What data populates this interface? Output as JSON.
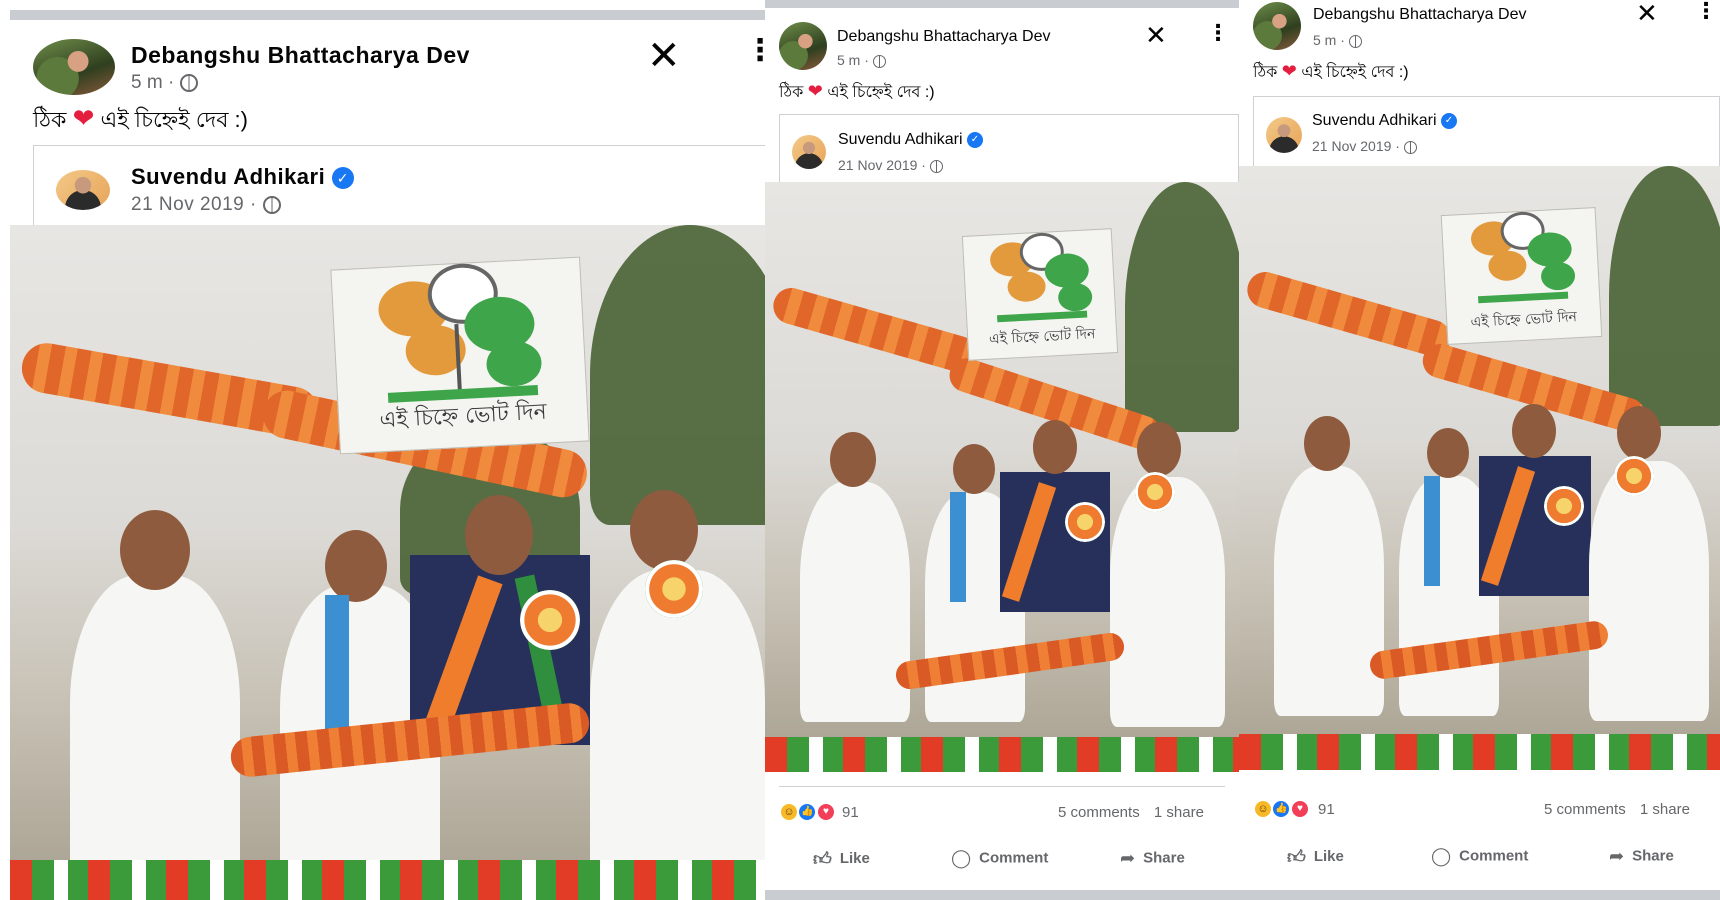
{
  "posts": [
    {
      "author": "Debangshu Bhattacharya Dev",
      "time": "5 m",
      "caption_before": "ঠিক",
      "caption_heart": "❤",
      "caption_after": "এই চিহ্নেই দেব :)",
      "close_icon": "close-icon",
      "more_icon": "more-vertical-icon",
      "shared": {
        "author": "Suvendu Adhikari",
        "date": "21 Nov 2019",
        "verified": true,
        "sign_text": "এই চিহ্নে ভোট দিন"
      }
    },
    {
      "author": "Debangshu Bhattacharya Dev",
      "time": "5 m",
      "caption_before": "ঠিক",
      "caption_heart": "❤",
      "caption_after": "এই চিহ্নেই দেব :)",
      "shared": {
        "author": "Suvendu Adhikari",
        "date": "21 Nov 2019",
        "verified": true,
        "sign_text": "এই চিহ্নে ভোট দিন"
      },
      "reactions": {
        "count": "91",
        "comments": "5 comments",
        "shares": "1 share",
        "icons": [
          "haha",
          "like",
          "love"
        ]
      },
      "actions": {
        "like": "Like",
        "comment": "Comment",
        "share": "Share"
      }
    },
    {
      "author": "Debangshu Bhattacharya Dev",
      "time": "5 m",
      "caption_before": "ঠিক",
      "caption_heart": "❤",
      "caption_after": "এই চিহ্নেই দেব :)",
      "shared": {
        "author": "Suvendu Adhikari",
        "date": "21 Nov 2019",
        "verified": true,
        "sign_text": "এই চিহ্নে ভোট দিন"
      },
      "reactions": {
        "count": "91",
        "comments": "5 comments",
        "shares": "1 share",
        "icons": [
          "haha",
          "like",
          "love"
        ]
      },
      "actions": {
        "like": "Like",
        "comment": "Comment",
        "share": "Share"
      }
    }
  ],
  "colors": {
    "accent": "#1877f2",
    "heart": "#e41e3f",
    "muted": "#65676b",
    "garland": "#f08a3c"
  }
}
